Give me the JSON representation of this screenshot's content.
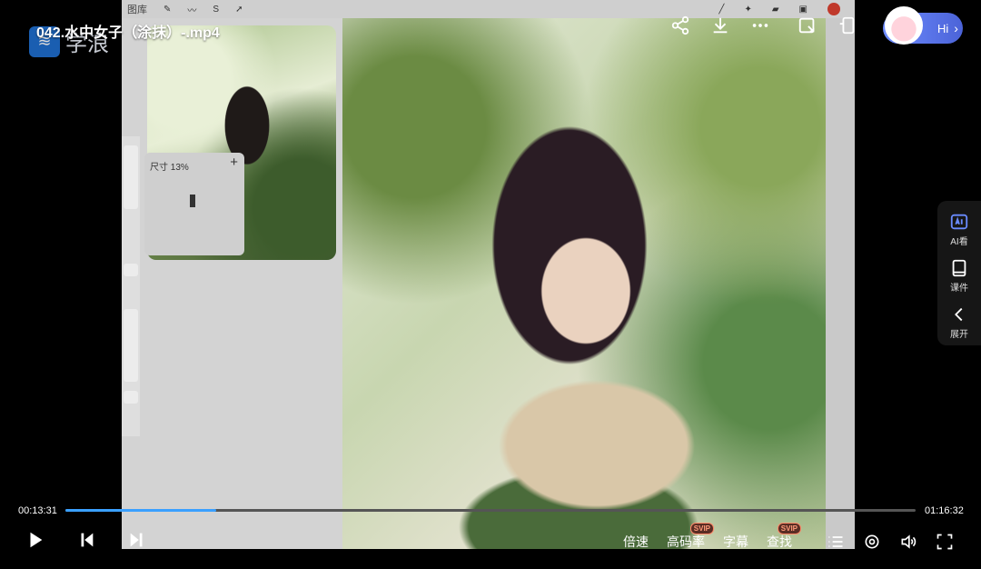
{
  "video": {
    "title": "042.水中女子（涂抹）-.mp4",
    "logo_text": "学浪",
    "procreate_gallery": "图库",
    "nav_size_label": "尺寸 13%",
    "nav_plus": "+"
  },
  "assistant": {
    "hi_label": "Hi",
    "chevron": "›"
  },
  "side_panel": [
    {
      "label": "AI看",
      "icon": "ai-view-icon"
    },
    {
      "label": "课件",
      "icon": "courseware-icon"
    },
    {
      "label": "展开",
      "icon": "chevron-left-icon"
    }
  ],
  "player": {
    "time_current": "00:13:31",
    "time_total": "01:16:32",
    "progress_fraction": 0.177,
    "speed_label": "倍速",
    "quality_label": "高码率",
    "quality_badge": "SVIP",
    "subtitle_label": "字幕",
    "search_label": "查找",
    "search_badge": "SVIP"
  },
  "colors": {
    "accent": "#3aa0ff",
    "hi_button": "#5c74e6",
    "ai_icon": "#6a8bff"
  }
}
